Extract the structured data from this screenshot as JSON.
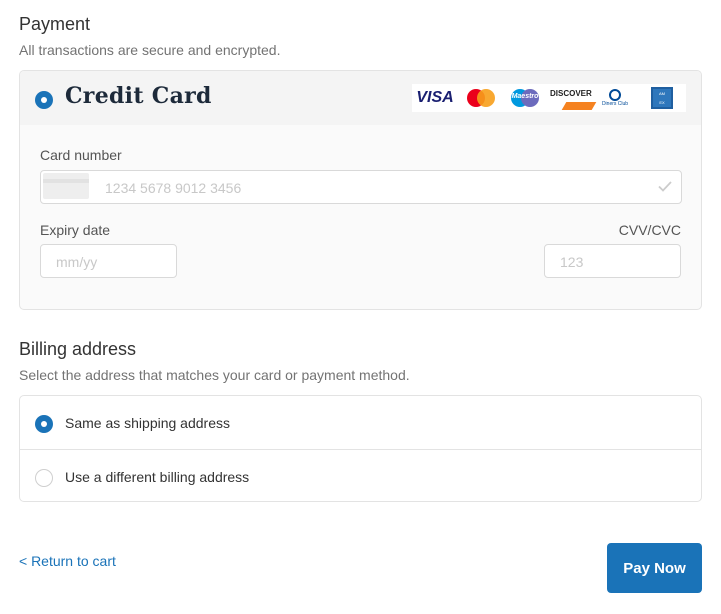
{
  "payment": {
    "title": "Payment",
    "subtitle": "All transactions are secure and encrypted.",
    "method_label": "Credit Card",
    "method_selected": true,
    "card_brands": [
      "VISA",
      "Mastercard",
      "Maestro",
      "DISCOVER",
      "Diners Club International",
      "American Express"
    ],
    "visa_text": "VISA",
    "maestro_text": "Maestro",
    "discover_text": "DISCOVER",
    "diners_text": "Diners Club",
    "card_number_label": "Card number",
    "card_number_placeholder": "1234 5678 9012 3456",
    "expiry_label": "Expiry date",
    "expiry_placeholder": "mm/yy",
    "cvv_label": "CVV/CVC",
    "cvv_placeholder": "123"
  },
  "billing": {
    "title": "Billing address",
    "subtitle": "Select the address that matches your card or payment method.",
    "options": [
      {
        "label": "Same as shipping address",
        "selected": true
      },
      {
        "label": "Use a different billing address",
        "selected": false
      }
    ]
  },
  "footer": {
    "return_link": "< Return to cart",
    "pay_button": "Pay Now"
  },
  "colors": {
    "accent": "#1a73b8",
    "text_muted": "#737373"
  }
}
